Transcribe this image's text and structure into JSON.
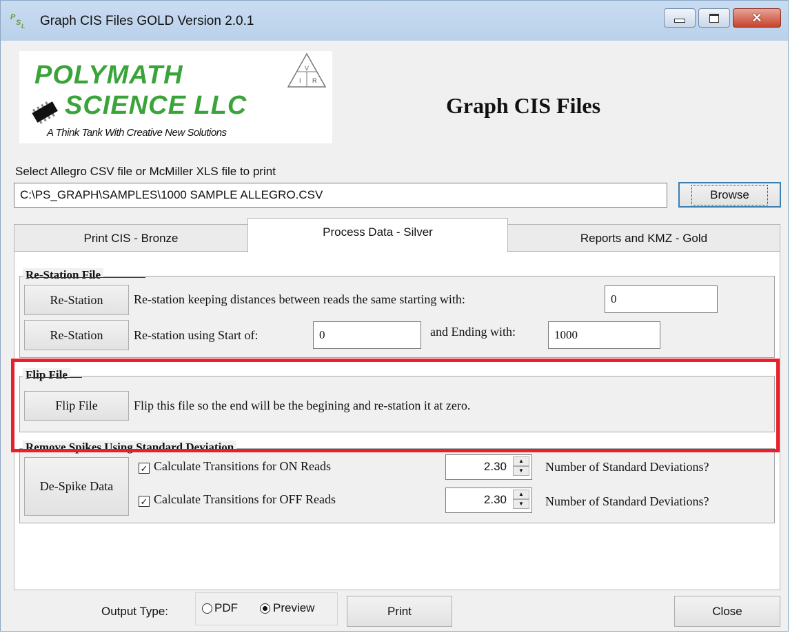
{
  "window": {
    "title": "Graph CIS Files GOLD Version 2.0.1",
    "icon_text": "PS_L",
    "controls": {
      "minimize": "minimize-icon",
      "maximize": "maximize-icon",
      "close": "close-icon"
    }
  },
  "logo": {
    "line1": "POLYMATH",
    "line2": "SCIENCE LLC",
    "tagline": "A Think Tank With Creative New Solutions",
    "triangle_letters": [
      "V",
      "I",
      "R"
    ]
  },
  "header": {
    "title": "Graph CIS Files"
  },
  "file_select": {
    "label": "Select Allegro CSV file or McMiller XLS file to print",
    "path": "C:\\PS_GRAPH\\SAMPLES\\1000 SAMPLE ALLEGRO.CSV",
    "browse_label": "Browse"
  },
  "tabs": [
    {
      "label": "Print CIS - Bronze",
      "active": false
    },
    {
      "label": "Process Data - Silver",
      "active": true
    },
    {
      "label": "Reports and KMZ - Gold",
      "active": false
    }
  ],
  "restation": {
    "legend": "Re-Station File",
    "row1": {
      "button": "Re-Station",
      "text": "Re-station keeping distances between reads the same starting with:",
      "value": "0"
    },
    "row2": {
      "button": "Re-Station",
      "text": "Re-station using Start of:",
      "start_value": "0",
      "end_text": "and Ending with:",
      "end_value": "1000"
    }
  },
  "flip": {
    "legend": "Flip File",
    "button": "Flip File",
    "text": "Flip this file so the end will be the begining and re-station it at zero."
  },
  "despike": {
    "legend": "Remove Spikes Using Standard Deviation",
    "button": "De-Spike Data",
    "on_label": "Calculate Transitions for ON Reads",
    "off_label": "Calculate Transitions for OFF Reads",
    "on_checked": true,
    "off_checked": true,
    "on_value": "2.30",
    "off_value": "2.30",
    "stddev_label_on": "Number of Standard Deviations?",
    "stddev_label_off": "Number of Standard Deviations?"
  },
  "footer": {
    "output_label": "Output Type:",
    "pdf_label": "PDF",
    "preview_label": "Preview",
    "selected": "Preview",
    "print_label": "Print",
    "close_label": "Close"
  },
  "colors": {
    "highlight": "#e8202a",
    "logo_green": "#3aa43a"
  }
}
